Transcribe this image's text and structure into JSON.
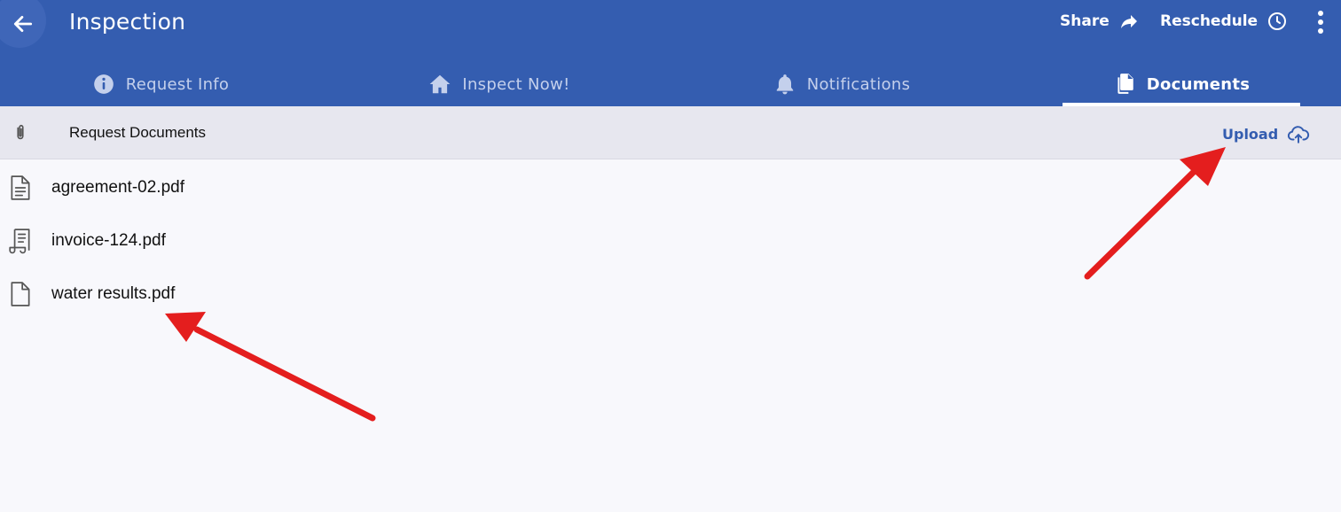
{
  "appbar": {
    "title": "Inspection",
    "share_label": "Share",
    "reschedule_label": "Reschedule"
  },
  "tabs": [
    {
      "label": "Request Info",
      "icon": "info-icon"
    },
    {
      "label": "Inspect Now!",
      "icon": "home-icon"
    },
    {
      "label": "Notifications",
      "icon": "bell-icon"
    },
    {
      "label": "Documents",
      "icon": "documents-icon",
      "active": true
    }
  ],
  "section": {
    "title": "Request Documents",
    "upload_label": "Upload"
  },
  "files": [
    {
      "name": "agreement-02.pdf",
      "icon": "document-lines-icon"
    },
    {
      "name": "invoice-124.pdf",
      "icon": "receipt-icon"
    },
    {
      "name": "water results.pdf",
      "icon": "blank-file-icon"
    }
  ],
  "colors": {
    "primary": "#345db0",
    "annotation_arrow": "#e41e1e"
  }
}
